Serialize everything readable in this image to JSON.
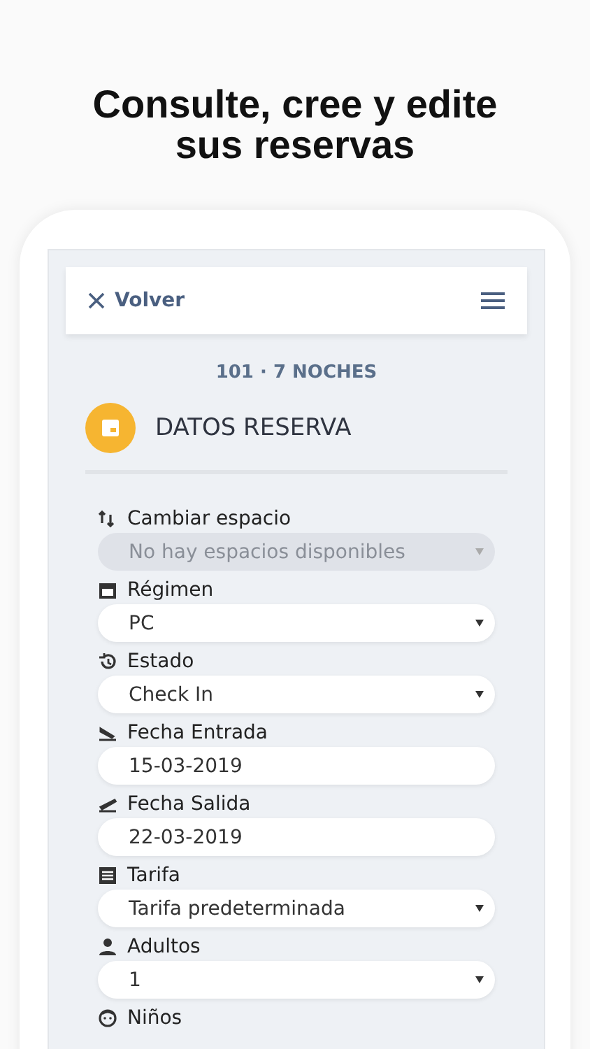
{
  "headline": "Consulte, cree y edite sus reservas",
  "header": {
    "back_label": "Volver"
  },
  "subtitle": "101 · 7 NOCHES",
  "section": {
    "title": "DATOS RESERVA"
  },
  "fields": [
    {
      "label": "Cambiar espacio",
      "kind": "select",
      "value": "No hay espacios disponibles",
      "disabled": true
    },
    {
      "label": "Régimen",
      "kind": "select",
      "value": "PC",
      "disabled": false
    },
    {
      "label": "Estado",
      "kind": "select",
      "value": "Check In",
      "disabled": false
    },
    {
      "label": "Fecha Entrada",
      "kind": "date",
      "value": "15-03-2019",
      "disabled": false
    },
    {
      "label": "Fecha Salida",
      "kind": "date",
      "value": "22-03-2019",
      "disabled": false
    },
    {
      "label": "Tarifa",
      "kind": "select",
      "value": "Tarifa predeterminada",
      "disabled": false
    },
    {
      "label": "Adultos",
      "kind": "select",
      "value": "1",
      "disabled": false
    },
    {
      "label": "Niños",
      "kind": "label"
    }
  ]
}
